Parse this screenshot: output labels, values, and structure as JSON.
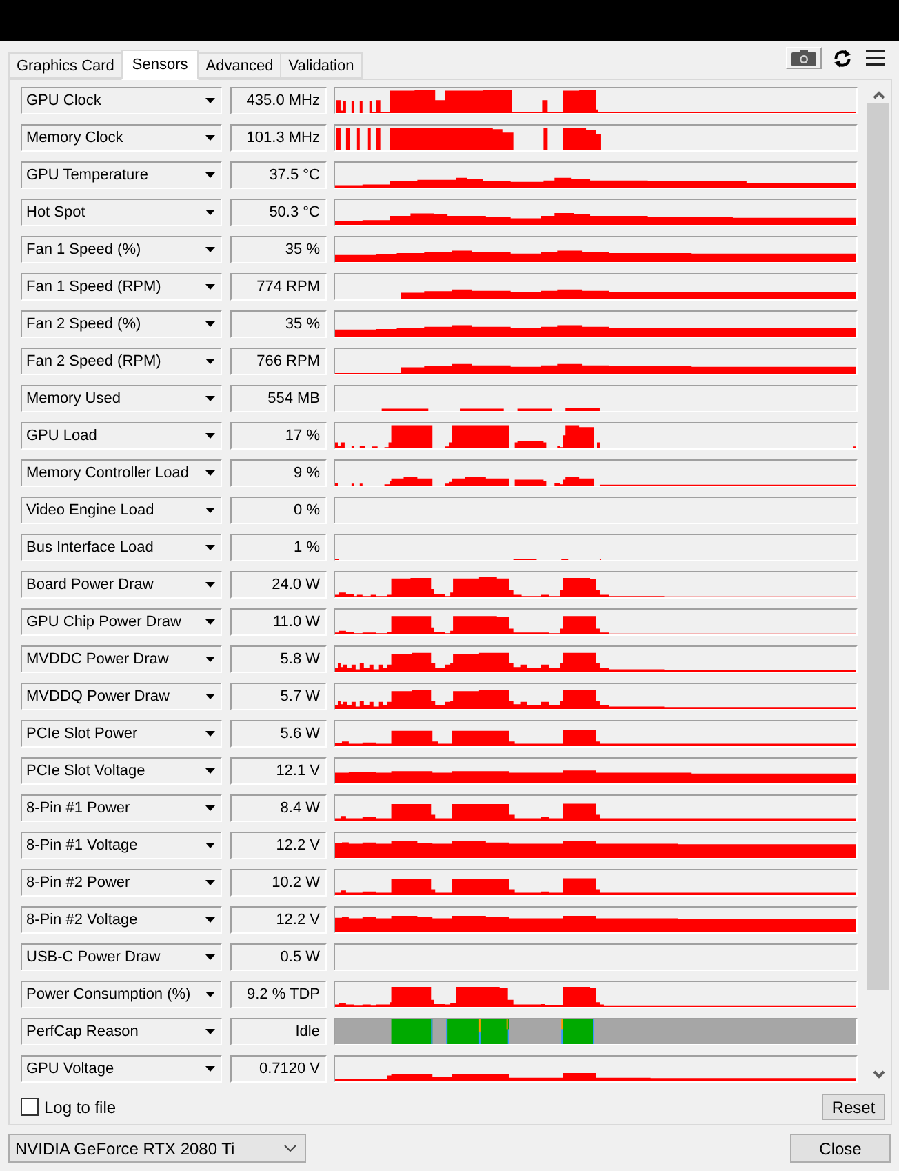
{
  "tabs": [
    {
      "label": "Graphics Card",
      "selected": false
    },
    {
      "label": "Sensors",
      "selected": true
    },
    {
      "label": "Advanced",
      "selected": false
    },
    {
      "label": "Validation",
      "selected": false
    }
  ],
  "sensors": [
    {
      "label": "GPU Clock",
      "value": "435.0 MHz",
      "kind": "graph"
    },
    {
      "label": "Memory Clock",
      "value": "101.3 MHz",
      "kind": "graph"
    },
    {
      "label": "GPU Temperature",
      "value": "37.5 °C",
      "kind": "graph"
    },
    {
      "label": "Hot Spot",
      "value": "50.3 °C",
      "kind": "graph"
    },
    {
      "label": "Fan 1 Speed (%)",
      "value": "35 %",
      "kind": "graph"
    },
    {
      "label": "Fan 1 Speed (RPM)",
      "value": "774 RPM",
      "kind": "graph"
    },
    {
      "label": "Fan 2 Speed (%)",
      "value": "35 %",
      "kind": "graph"
    },
    {
      "label": "Fan 2 Speed (RPM)",
      "value": "766 RPM",
      "kind": "graph"
    },
    {
      "label": "Memory Used",
      "value": "554 MB",
      "kind": "graph"
    },
    {
      "label": "GPU Load",
      "value": "17 %",
      "kind": "graph"
    },
    {
      "label": "Memory Controller Load",
      "value": "9 %",
      "kind": "graph"
    },
    {
      "label": "Video Engine Load",
      "value": "0 %",
      "kind": "graph"
    },
    {
      "label": "Bus Interface Load",
      "value": "1 %",
      "kind": "graph"
    },
    {
      "label": "Board Power Draw",
      "value": "24.0 W",
      "kind": "graph"
    },
    {
      "label": "GPU Chip Power Draw",
      "value": "11.0 W",
      "kind": "graph"
    },
    {
      "label": "MVDDC Power Draw",
      "value": "5.8 W",
      "kind": "graph"
    },
    {
      "label": "MVDDQ Power Draw",
      "value": "5.7 W",
      "kind": "graph"
    },
    {
      "label": "PCIe Slot Power",
      "value": "5.6 W",
      "kind": "graph"
    },
    {
      "label": "PCIe Slot Voltage",
      "value": "12.1 V",
      "kind": "graph"
    },
    {
      "label": "8-Pin #1 Power",
      "value": "8.4 W",
      "kind": "graph"
    },
    {
      "label": "8-Pin #1 Voltage",
      "value": "12.2 V",
      "kind": "graph"
    },
    {
      "label": "8-Pin #2 Power",
      "value": "10.2 W",
      "kind": "graph"
    },
    {
      "label": "8-Pin #2 Voltage",
      "value": "12.2 V",
      "kind": "graph"
    },
    {
      "label": "USB-C Power Draw",
      "value": "0.5 W",
      "kind": "graph"
    },
    {
      "label": "Power Consumption (%)",
      "value": "9.2 % TDP",
      "kind": "graph"
    },
    {
      "label": "PerfCap Reason",
      "value": "Idle",
      "kind": "state"
    },
    {
      "label": "GPU Voltage",
      "value": "0.7120 V",
      "kind": "graph"
    }
  ],
  "log_to_file": {
    "label": "Log to file",
    "checked": false
  },
  "reset_button": "Reset",
  "device_select": {
    "value": "NVIDIA GeForce RTX 2080 Ti"
  },
  "close_button": "Close"
}
